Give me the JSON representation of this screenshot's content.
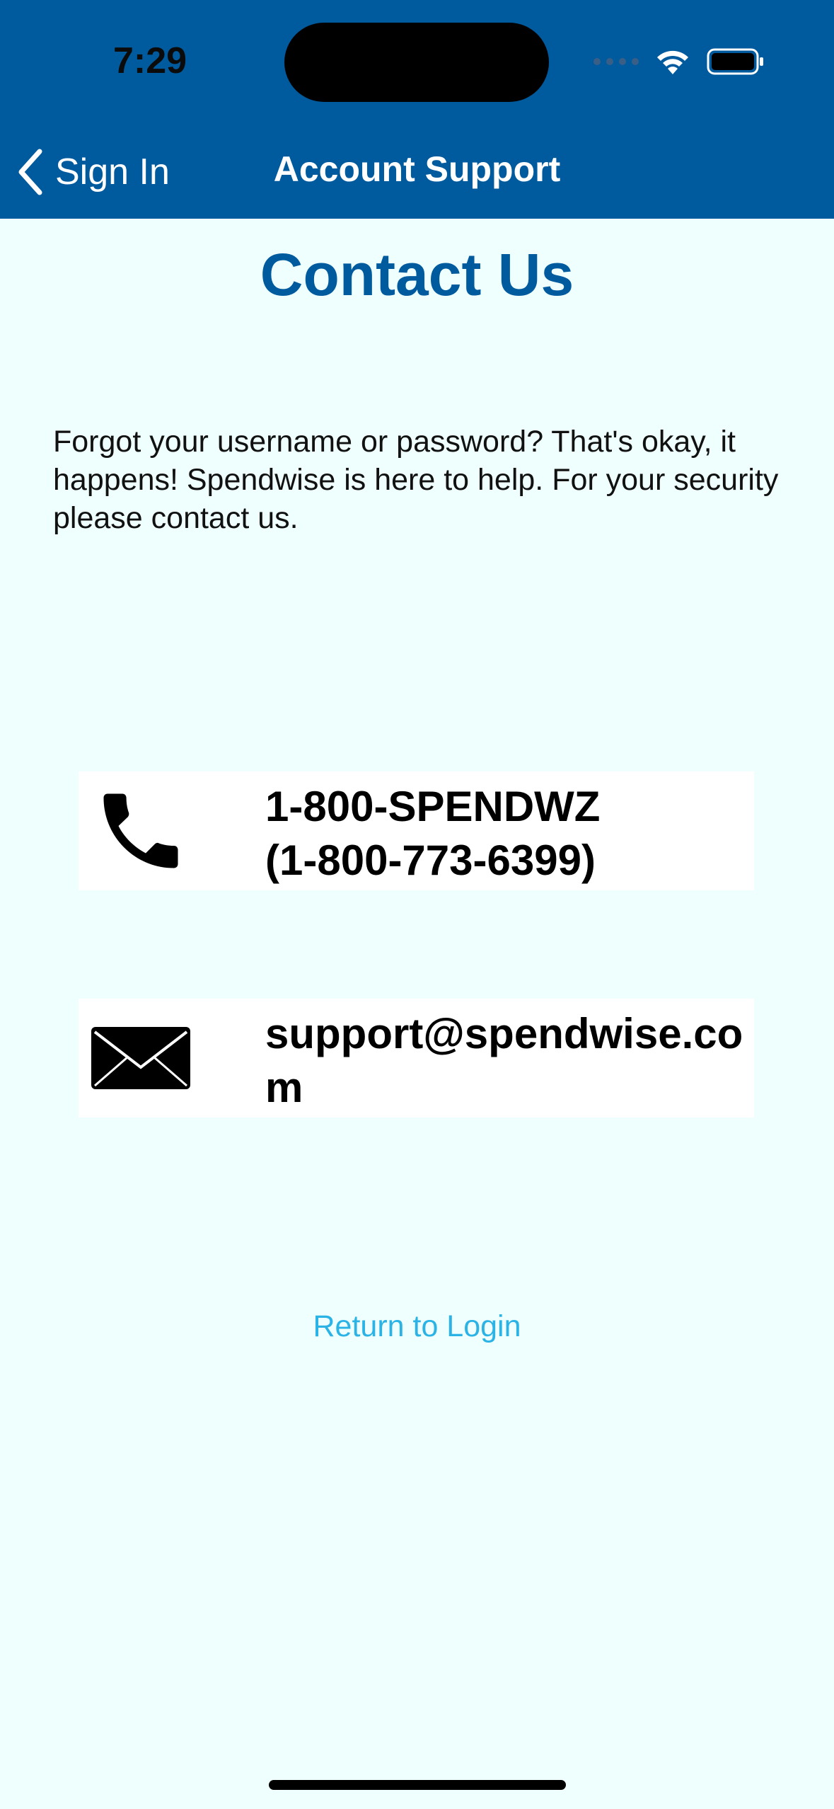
{
  "status_bar": {
    "time": "7:29"
  },
  "nav": {
    "back_label": "Sign In",
    "title": "Account Support"
  },
  "page": {
    "title": "Contact Us",
    "intro": "Forgot your username or password? That's okay, it happens! Spendwise is here to help. For your security please contact us."
  },
  "contacts": {
    "phone_line1": "1-800-SPENDWZ",
    "phone_line2": "(1-800-773-6399)",
    "email": "support@spendwise.com",
    "phone_icon": "phone-icon",
    "email_icon": "envelope-icon"
  },
  "actions": {
    "return_label": "Return to Login"
  },
  "colors": {
    "header": "#005a9e",
    "title": "#005a9e",
    "background": "#eefffe",
    "link": "#2bb3e6"
  }
}
